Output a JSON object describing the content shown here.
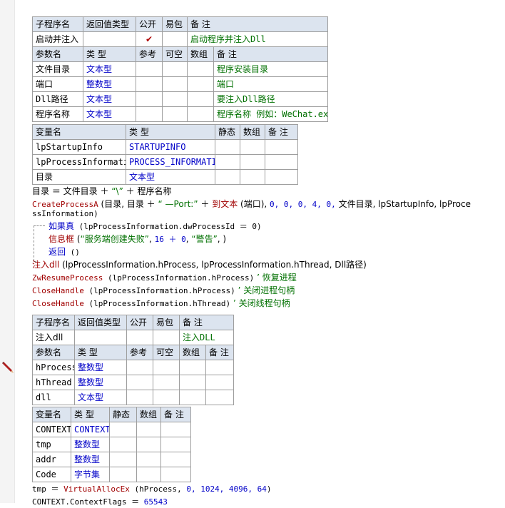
{
  "sub1": {
    "header": [
      "子程序名",
      "返回值类型",
      "公开",
      "易包",
      "备 注"
    ],
    "name": "启动并注入",
    "ret_type": "",
    "is_public": "✔",
    "epkg": "",
    "remark": "启动程序并注入Dll",
    "param_header": [
      "参数名",
      "类 型",
      "参考",
      "可空",
      "数组",
      "备 注"
    ],
    "params": [
      {
        "name": "文件目录",
        "type": "文本型",
        "ref": "",
        "nullable": "",
        "array": "",
        "remark": "程序安装目录"
      },
      {
        "name": "端口",
        "type": "整数型",
        "ref": "",
        "nullable": "",
        "array": "",
        "remark": "端口"
      },
      {
        "name": "Dll路径",
        "type": "文本型",
        "ref": "",
        "nullable": "",
        "array": "",
        "remark": "要注入Dll路径"
      },
      {
        "name": "程序名称",
        "type": "文本型",
        "ref": "",
        "nullable": "",
        "array": "",
        "remark": "程序名称 例如：WeChat.exe"
      }
    ]
  },
  "vars1": {
    "header": [
      "变量名",
      "类 型",
      "静态",
      "数组",
      "备 注"
    ],
    "rows": [
      {
        "name": "lpStartupInfo",
        "type": "STARTUPINFO",
        "static": "",
        "array": "",
        "remark": ""
      },
      {
        "name": "lpProcessInformation",
        "type": "PROCESS_INFORMATION",
        "static": "",
        "array": "",
        "remark": ""
      },
      {
        "name": "目录",
        "type": "文本型",
        "static": "",
        "array": "",
        "remark": ""
      }
    ]
  },
  "code1": {
    "line1": {
      "a": "目录",
      "b": " ＝ ",
      "c": "文件目录",
      "d": " ＋ ",
      "e": "“\\”",
      "f": " ＋ ",
      "g": "程序名称"
    },
    "line2": {
      "fn": "CreateProcessA",
      "p1": " (目录, 目录 ＋ ",
      "s1": "“ —Port:”",
      "p2": " ＋ ",
      "fn2": "到文本",
      "p3": " (端口), ",
      "n": "0, 0, 0, 4, 0,",
      "p4": " 文件目录, lpStartupInfo, lpProce"
    },
    "line2b": "ssInformation)",
    "line3": {
      "kw": "如果真",
      "p": " (lpProcessInformation.dwProcessId ＝ 0)"
    },
    "line4": {
      "kw": "信息框",
      "p1": " (",
      "s": "“服务端创建失败”",
      "p2": ", ",
      "n": "16 ＋ 0",
      "p3": ", ",
      "s2": "“警告”",
      "p4": ", )"
    },
    "line5": {
      "kw": "返回",
      "p": " ()"
    },
    "line6": {
      "fn": "注入dll",
      "p": " (lpProcessInformation.hProcess, lpProcessInformation.hThread, Dll路径)"
    },
    "line7": {
      "fn": "ZwResumeProcess",
      "p": " (lpProcessInformation.hProcess)",
      "c": "  ’ 恢复进程"
    },
    "line8": {
      "fn": "CloseHandle",
      "p": " (lpProcessInformation.hProcess)",
      "c": "  ’ 关闭进程句柄"
    },
    "line9": {
      "fn": "CloseHandle",
      "p": " (lpProcessInformation.hThread)",
      "c": "  ’ 关闭线程句柄"
    }
  },
  "sub2": {
    "header": [
      "子程序名",
      "返回值类型",
      "公开",
      "易包",
      "备 注"
    ],
    "name": "注入dll",
    "ret_type": "",
    "is_public": "",
    "epkg": "",
    "remark": "注入DLL",
    "param_header": [
      "参数名",
      "类 型",
      "参考",
      "可空",
      "数组",
      "备 注"
    ],
    "params": [
      {
        "name": "hProcess",
        "type": "整数型",
        "ref": "",
        "nullable": "",
        "array": "",
        "remark": ""
      },
      {
        "name": "hThread",
        "type": "整数型",
        "ref": "",
        "nullable": "",
        "array": "",
        "remark": ""
      },
      {
        "name": "dll",
        "type": "文本型",
        "ref": "",
        "nullable": "",
        "array": "",
        "remark": ""
      }
    ]
  },
  "vars2": {
    "header": [
      "变量名",
      "类 型",
      "静态",
      "数组",
      "备 注"
    ],
    "rows": [
      {
        "name": "CONTEXT",
        "type": "CONTEXT",
        "static": "",
        "array": "",
        "remark": ""
      },
      {
        "name": "tmp",
        "type": "整数型",
        "static": "",
        "array": "",
        "remark": ""
      },
      {
        "name": "addr",
        "type": "整数型",
        "static": "",
        "array": "",
        "remark": ""
      },
      {
        "name": "Code",
        "type": "字节集",
        "static": "",
        "array": "",
        "remark": ""
      }
    ]
  },
  "code2": {
    "line1": {
      "a": "tmp ＝ ",
      "fn": "VirtualAllocEx",
      "p": " (hProcess, ",
      "n": "0, 1024, 4096, 64",
      "q": ")"
    },
    "line2": {
      "a": "CONTEXT.ContextFlags ＝ ",
      "n": "65543"
    }
  },
  "icons": {
    "gutter_marker": "pencil-icon"
  }
}
